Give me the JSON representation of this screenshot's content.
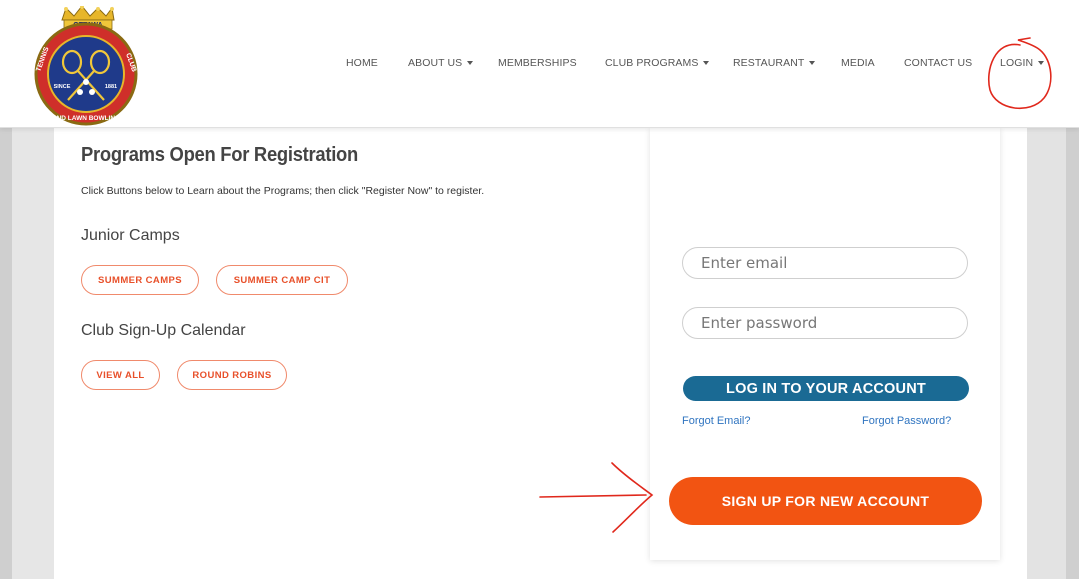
{
  "logo": {
    "club_name_top": "OTTAWA",
    "ring_text_left": "TENNIS",
    "ring_text_right": "CLUB",
    "ring_text_bottom": "AND LAWN BOWLING",
    "since_label": "SINCE",
    "year": "1881"
  },
  "nav": {
    "items": [
      {
        "label": "HOME",
        "caret": false
      },
      {
        "label": "ABOUT US",
        "caret": true
      },
      {
        "label": "MEMBERSHIPS",
        "caret": false
      },
      {
        "label": "CLUB PROGRAMS",
        "caret": true
      },
      {
        "label": "RESTAURANT",
        "caret": true
      },
      {
        "label": "MEDIA",
        "caret": false
      },
      {
        "label": "CONTACT US",
        "caret": false
      },
      {
        "label": "LOGIN",
        "caret": true
      }
    ]
  },
  "programs": {
    "title": "Programs Open For Registration",
    "intro": "Click Buttons below to Learn about the Programs; then click \"Register Now\" to register.",
    "junior_heading": "Junior Camps",
    "junior_buttons": [
      "SUMMER CAMPS",
      "SUMMER CAMP CIT"
    ],
    "calendar_heading": "Club Sign-Up Calendar",
    "calendar_buttons": [
      "VIEW ALL",
      "ROUND ROBINS"
    ]
  },
  "login": {
    "email_placeholder": "Enter email",
    "password_placeholder": "Enter password",
    "login_button": "LOG IN TO YOUR ACCOUNT",
    "forgot_email": "Forgot Email?",
    "forgot_password": "Forgot Password?",
    "signup_button": "SIGN UP FOR NEW ACCOUNT"
  },
  "colors": {
    "accent_orange": "#f25412",
    "login_blue": "#1a6a94",
    "pill_orange": "#e8502a",
    "link_blue": "#2f74c0",
    "annotation_red": "#e0281c"
  }
}
